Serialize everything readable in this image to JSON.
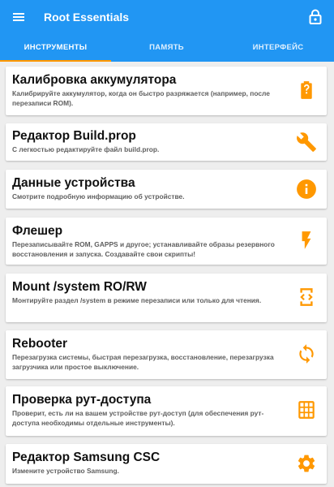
{
  "app_title": "Root Essentials",
  "colors": {
    "primary": "#2196f3",
    "accent": "#ff9800",
    "icon": "#ff9800"
  },
  "toolbar": {
    "menu_icon": "hamburger-menu-icon",
    "lock_icon": "lock-icon"
  },
  "tabs": [
    {
      "label": "ИНСТРУМЕНТЫ",
      "selected": true
    },
    {
      "label": "ПАМЯТЬ",
      "selected": false
    },
    {
      "label": "ИНТЕРФЕЙС",
      "selected": false
    }
  ],
  "cards": [
    {
      "title": "Калибровка аккумулятора",
      "desc": "Калибрируйте аккумулятор, когда он быстро разряжается (например, после перезаписи ROM).",
      "icon": "battery-alert-icon"
    },
    {
      "title": "Редактор Build.prop",
      "desc": "С легкостью редактируйте файл build.prop.",
      "icon": "wrench-icon"
    },
    {
      "title": "Данные устройства",
      "desc": "Смотрите подробную информацию об устройстве.",
      "icon": "info-icon"
    },
    {
      "title": "Флешер",
      "desc": "Перезаписывайте ROM, GAPPS и другое; устанавливайте образы резервного восстановления и запуска. Создавайте свои скрипты!",
      "icon": "flash-icon"
    },
    {
      "title": "Mount /system RO/RW",
      "desc": "Монтируйте раздел /system в режиме перезаписи или только для чтения.",
      "icon": "code-device-icon"
    },
    {
      "title": "Rebooter",
      "desc": "Перезагрузка системы, быстрая перезагрузка, восстановление, перезагрузка загрузчика или простое выключение.",
      "icon": "refresh-icon"
    },
    {
      "title": "Проверка рут-доступа",
      "desc": "Проверит, есть ли на вашем устройстве рут-доступ (для обеспечения рут-доступа необходимы отдельные инструменты).",
      "icon": "grid-check-icon"
    },
    {
      "title": "Редактор Samsung CSC",
      "desc": "Измените устройство Samsung.",
      "icon": "gear-icon"
    }
  ]
}
